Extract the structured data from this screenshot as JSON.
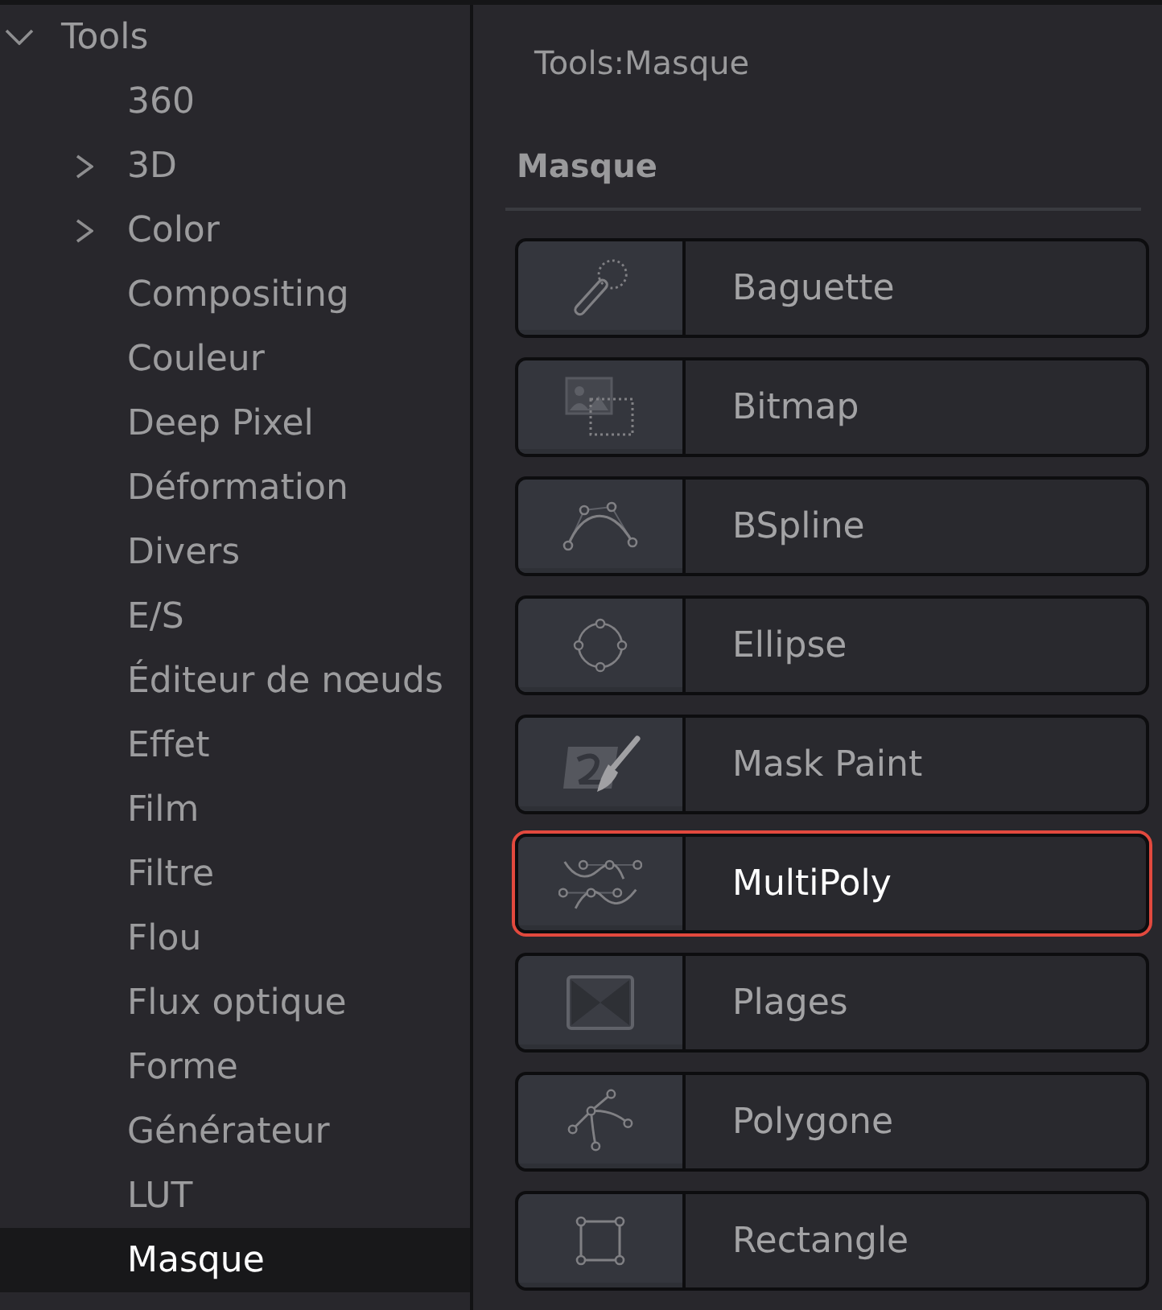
{
  "tree": {
    "label": "Tools",
    "expanded": true,
    "selected": false,
    "children": [
      {
        "label": "360",
        "selected": false
      },
      {
        "label": "3D",
        "expanded": false,
        "selected": false
      },
      {
        "label": "Color",
        "expanded": false,
        "selected": false
      },
      {
        "label": "Compositing",
        "selected": false
      },
      {
        "label": "Couleur",
        "selected": false
      },
      {
        "label": "Deep Pixel",
        "selected": false
      },
      {
        "label": "Déformation",
        "selected": false
      },
      {
        "label": "Divers",
        "selected": false
      },
      {
        "label": "E/S",
        "selected": false
      },
      {
        "label": "Éditeur de nœuds",
        "selected": false
      },
      {
        "label": "Effet",
        "selected": false
      },
      {
        "label": "Film",
        "selected": false
      },
      {
        "label": "Filtre",
        "selected": false
      },
      {
        "label": "Flou",
        "selected": false
      },
      {
        "label": "Flux optique",
        "selected": false
      },
      {
        "label": "Forme",
        "selected": false
      },
      {
        "label": "Générateur",
        "selected": false
      },
      {
        "label": "LUT",
        "selected": false
      },
      {
        "label": "Masque",
        "selected": true
      }
    ]
  },
  "panel": {
    "breadcrumb": "Tools:Masque",
    "section_title": "Masque",
    "tools": [
      {
        "label": "Baguette",
        "selected": false
      },
      {
        "label": "Bitmap",
        "selected": false
      },
      {
        "label": "BSpline",
        "selected": false
      },
      {
        "label": "Ellipse",
        "selected": false
      },
      {
        "label": "Mask Paint",
        "selected": false
      },
      {
        "label": "MultiPoly",
        "selected": true
      },
      {
        "label": "Plages",
        "selected": false
      },
      {
        "label": "Polygone",
        "selected": false
      },
      {
        "label": "Rectangle",
        "selected": false
      }
    ]
  }
}
